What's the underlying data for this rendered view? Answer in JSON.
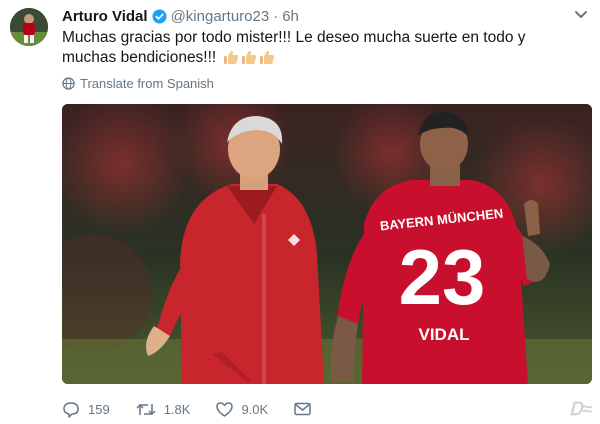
{
  "tweet": {
    "author_name": "Arturo Vidal",
    "handle": "@kingarturo23",
    "separator": "·",
    "time": "6h",
    "text": "Muchas gracias por todo mister!!! Le deseo mucha suerte en todo y muchas bendiciones!!!",
    "emoji": [
      "thumbs-up-icon",
      "thumbs-up-icon",
      "thumbs-up-icon"
    ],
    "translate_label": "Translate from Spanish"
  },
  "media": {
    "jersey_sponsor": "BAYERN MÜNCHEN",
    "jersey_number": "23",
    "jersey_name": "VIDAL"
  },
  "actions": {
    "replies": "159",
    "retweets": "1.8K",
    "likes": "9.0K"
  },
  "watermark": "Ꭰ≈"
}
